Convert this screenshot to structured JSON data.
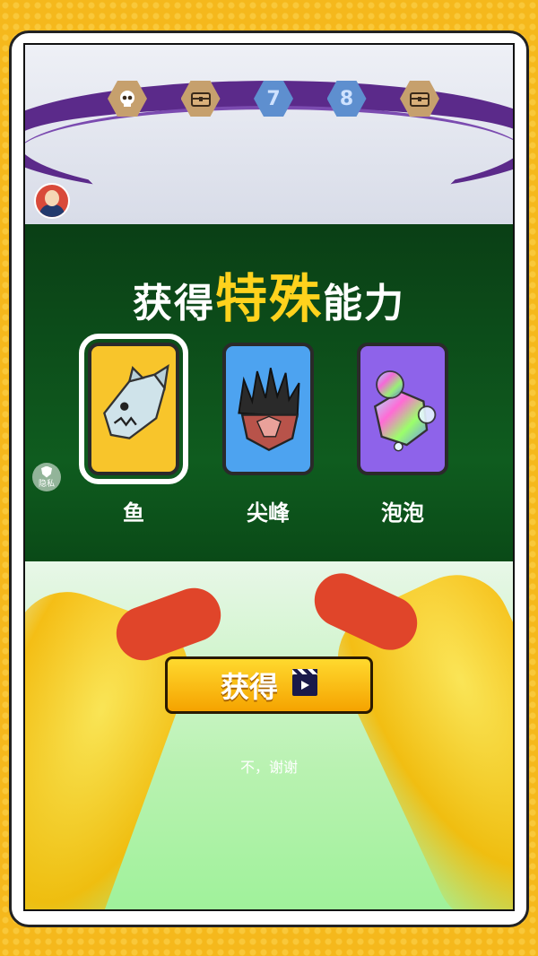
{
  "progress": {
    "stages": [
      {
        "type": "boss",
        "icon": "skull-icon"
      },
      {
        "type": "chest",
        "icon": "chest-icon"
      },
      {
        "type": "number",
        "label": "7"
      },
      {
        "type": "number",
        "label": "8"
      },
      {
        "type": "chest",
        "icon": "chest-icon"
      }
    ]
  },
  "title": {
    "prefix": "获得",
    "highlight": "特殊",
    "suffix": "能力"
  },
  "cards": [
    {
      "label": "鱼",
      "color": "#f8c52b",
      "selected": true
    },
    {
      "label": "尖峰",
      "color": "#4da3f0",
      "selected": false
    },
    {
      "label": "泡泡",
      "color": "#8e63ea",
      "selected": false
    }
  ],
  "privacy_label": "隐私",
  "get_button_label": "获得",
  "decline_label": "不，谢谢",
  "colors": {
    "accent": "#ffd21d",
    "panel": "#0f5c1f",
    "button": "#f5a300"
  }
}
